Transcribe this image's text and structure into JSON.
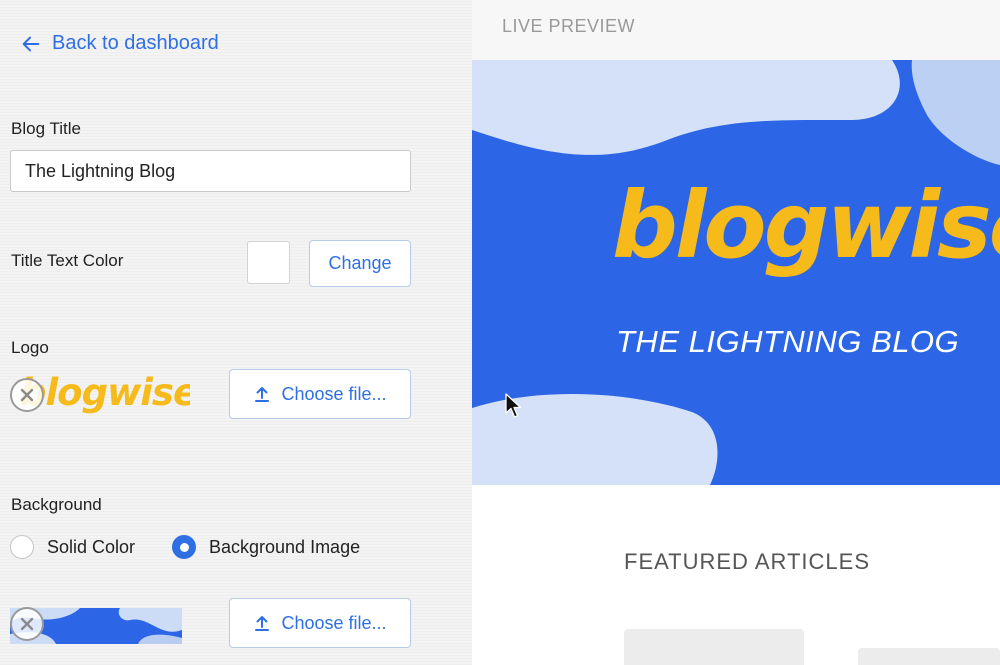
{
  "sidebar": {
    "back_label": "Back to dashboard",
    "blog_title": {
      "label": "Blog Title",
      "value": "The Lightning Blog"
    },
    "title_color": {
      "label": "Title Text Color",
      "swatch": "#ffffff",
      "button": "Change"
    },
    "logo": {
      "label": "Logo",
      "thumb_text": "blogwise",
      "button": "Choose file..."
    },
    "background": {
      "label": "Background",
      "options": [
        {
          "label": "Solid Color",
          "selected": false
        },
        {
          "label": "Background Image",
          "selected": true
        }
      ],
      "button": "Choose file..."
    }
  },
  "preview": {
    "label": "LIVE PREVIEW",
    "logo_text": "blogwise",
    "subtitle": "THE LIGHTNING BLOG",
    "featured_label": "FEATURED ARTICLES"
  },
  "colors": {
    "accent": "#2f6fe4",
    "hero_blue": "#2c66e6",
    "logo_yellow": "#f7ba1b",
    "light_blue": "#cddcf6"
  },
  "icons": {
    "back": "arrow-left-icon",
    "upload": "upload-icon",
    "remove": "close-circle-icon",
    "cursor": "mouse-pointer-icon"
  }
}
